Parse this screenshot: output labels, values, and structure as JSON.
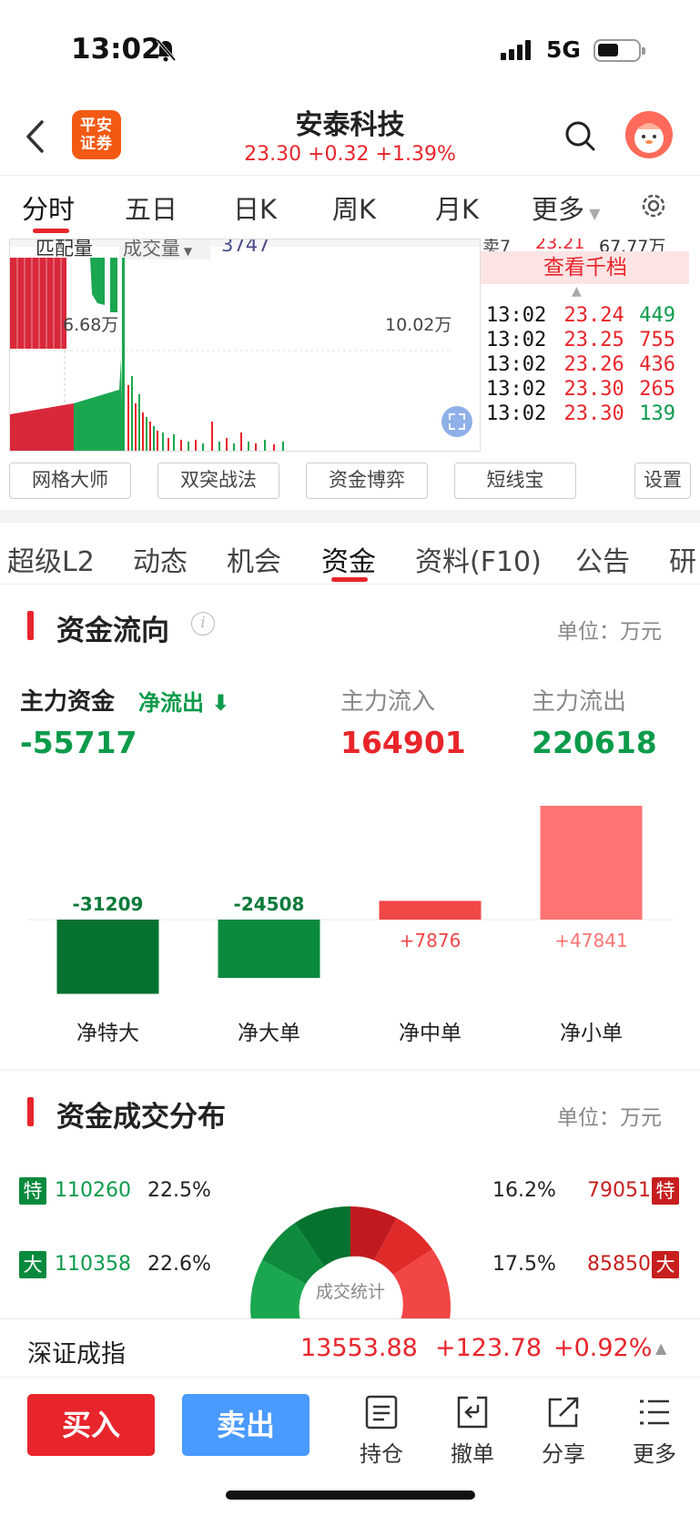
{
  "status": {
    "time": "13:02",
    "network": "5G"
  },
  "header": {
    "logo_line1": "平安",
    "logo_line2": "证券",
    "stock_name": "安泰科技",
    "quote": "23.30 +0.32 +1.39%"
  },
  "period_tabs": [
    "分时",
    "五日",
    "日K",
    "周K",
    "月K",
    "更多"
  ],
  "intraday": {
    "match_label": "匹配量",
    "volume_label": "成交量",
    "volume_value": "3747",
    "left_value": "6.68万",
    "right_value": "10.02万"
  },
  "order_book": {
    "sell7_label": "卖7",
    "sell7_price": "23.21",
    "sell7_vol": "67.77万",
    "view_depth": "查看千档",
    "ticks": [
      {
        "time": "13:02",
        "price": "23.24",
        "vol": "449",
        "side": "buy"
      },
      {
        "time": "13:02",
        "price": "23.25",
        "vol": "755",
        "side": "sell"
      },
      {
        "time": "13:02",
        "price": "23.26",
        "vol": "436",
        "side": "sell"
      },
      {
        "time": "13:02",
        "price": "23.30",
        "vol": "265",
        "side": "sell"
      },
      {
        "time": "13:02",
        "price": "23.30",
        "vol": "139",
        "side": "buy"
      }
    ]
  },
  "tools": [
    "网格大师",
    "双突战法",
    "资金博弈",
    "短线宝",
    "设置"
  ],
  "info_tabs": [
    "超级L2",
    "动态",
    "机会",
    "资金",
    "资料(F10)",
    "公告",
    "研"
  ],
  "fund_flow": {
    "title": "资金流向",
    "unit": "单位：万元",
    "main_label": "主力资金",
    "net_label": "净流出",
    "main_value": "-55717",
    "inflow_label": "主力流入",
    "inflow_value": "164901",
    "outflow_label": "主力流出",
    "outflow_value": "220618"
  },
  "chart_data": {
    "type": "bar",
    "categories": [
      "净特大",
      "净大单",
      "净中单",
      "净小单"
    ],
    "values": [
      -31209,
      -24508,
      7876,
      47841
    ],
    "labels": [
      "-31209",
      "-24508",
      "+7876",
      "+47841"
    ],
    "colors": [
      "#06722f",
      "#0a8a3e",
      "#f04747",
      "#ff7373"
    ]
  },
  "distribution": {
    "title": "资金成交分布",
    "unit": "单位：万元",
    "rows": [
      {
        "tag_left": "特",
        "left_value": "110260",
        "left_pct": "22.5%",
        "right_pct": "16.2%",
        "right_value": "79051",
        "tag_right": "特"
      },
      {
        "tag_left": "大",
        "left_value": "110358",
        "left_pct": "22.6%",
        "right_pct": "17.5%",
        "right_value": "85850",
        "tag_right": "大"
      }
    ],
    "donut_label": "成交统计"
  },
  "index_bar": {
    "name": "深证成指",
    "value": "13553.88",
    "change": "+123.78",
    "pct": "+0.92%"
  },
  "actions": {
    "buy": "买入",
    "sell": "卖出",
    "items": [
      "持仓",
      "撤单",
      "分享",
      "更多"
    ]
  }
}
